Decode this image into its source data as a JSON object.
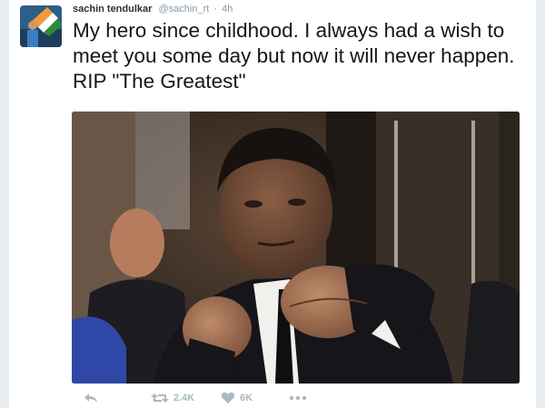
{
  "tweet": {
    "display_name": "sachin tendulkar",
    "handle": "@sachin_rt",
    "separator": "·",
    "timestamp": "4h",
    "text": "My hero since childhood. I always had a wish to meet you some day but now it will never happen. RIP \"The Greatest\""
  },
  "actions": {
    "reply_icon": "reply-icon",
    "retweet_icon": "retweet-icon",
    "retweet_count": "2.4K",
    "like_icon": "heart-icon",
    "like_count": "6K",
    "more_icon": "more-icon"
  },
  "colors": {
    "background": "#e6ecf0",
    "card": "#ffffff",
    "text": "#14171a",
    "muted": "#8899a6",
    "icon": "#aab8c2"
  }
}
